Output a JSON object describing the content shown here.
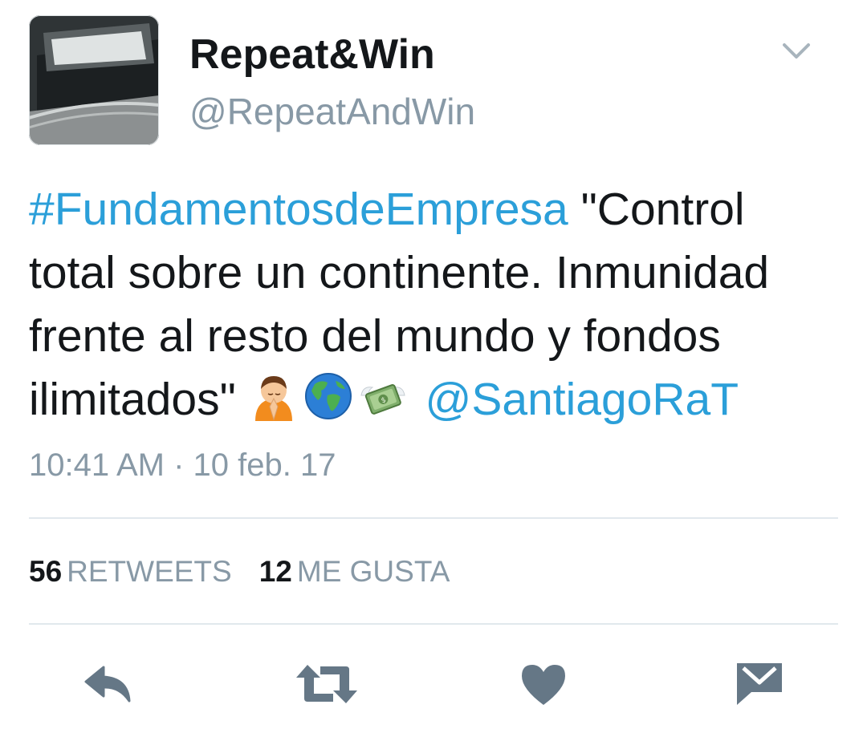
{
  "header": {
    "display_name": "Repeat&Win",
    "handle": "@RepeatAndWin",
    "avatar_icon": "avatar-photo",
    "menu_icon": "chevron-down-icon"
  },
  "tweet": {
    "hashtag": "#FundamentosdeEmpresa",
    "text": " \"Control total sobre un continente. Inmunidad frente al resto del mundo y fondos ilimitados\" ",
    "emojis": [
      "person-bowing-emoji",
      "globe-emoji",
      "money-with-wings-emoji"
    ],
    "mention": "@SantiagoRaT",
    "timestamp": "10:41 AM · 10 feb. 17"
  },
  "stats": {
    "retweets_count": "56",
    "retweets_label": "RETWEETS",
    "likes_count": "12",
    "likes_label": "ME GUSTA"
  },
  "actions": [
    "reply-icon",
    "retweet-icon",
    "like-icon",
    "direct-message-icon"
  ],
  "colors": {
    "link": "#2b9fd9",
    "secondary_text": "#8899a6",
    "primary_text": "#14171a",
    "action_icon": "#657786",
    "divider": "#e1e8ed"
  }
}
